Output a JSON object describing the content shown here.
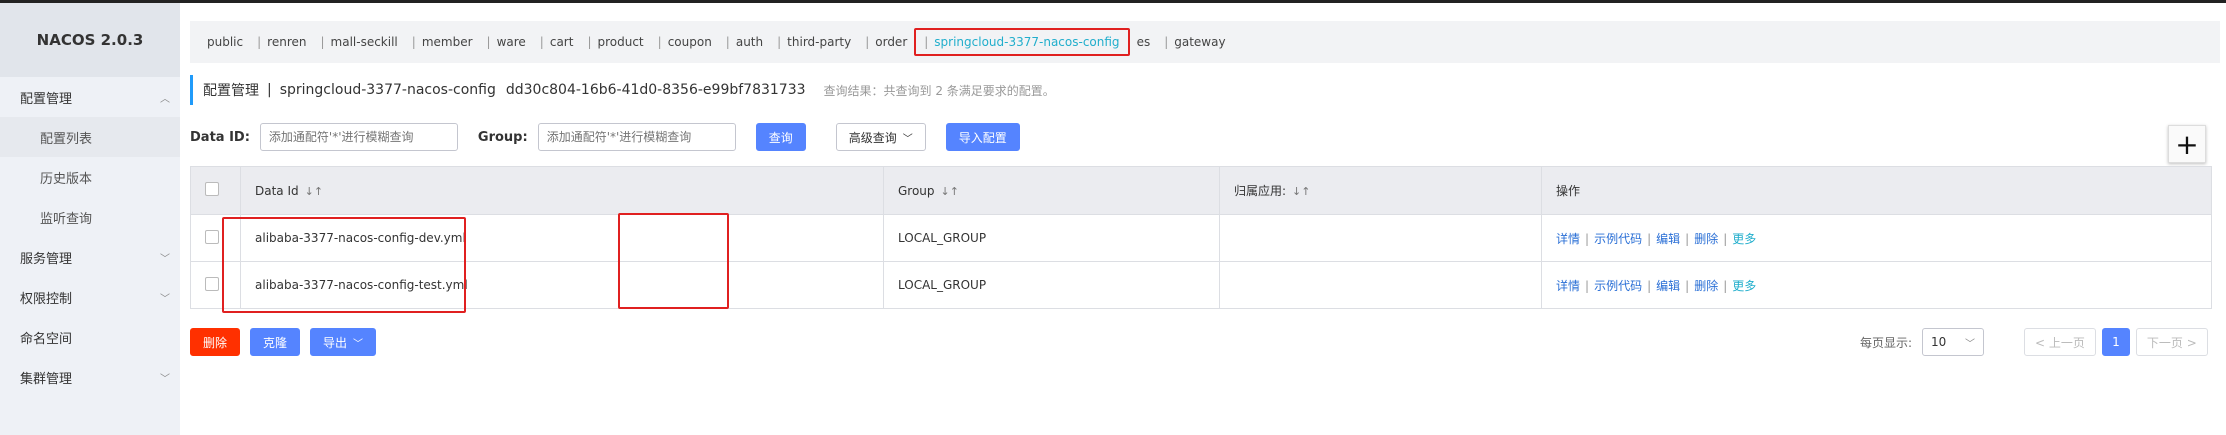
{
  "sidebar": {
    "brand": "NACOS 2.0.3",
    "items": [
      {
        "label": "配置管理",
        "chevron": "︿"
      },
      {
        "label": "配置列表"
      },
      {
        "label": "历史版本"
      },
      {
        "label": "监听查询"
      },
      {
        "label": "服务管理",
        "chevron": "﹀"
      },
      {
        "label": "权限控制",
        "chevron": "﹀"
      },
      {
        "label": "命名空间"
      },
      {
        "label": "集群管理",
        "chevron": "﹀"
      }
    ]
  },
  "namespaces": [
    "public",
    "renren",
    "mall-seckill",
    "member",
    "ware",
    "cart",
    "product",
    "coupon",
    "auth",
    "third-party",
    "order",
    "springcloud-3377-nacos-config",
    "es",
    "gateway"
  ],
  "header": {
    "title": "配置管理",
    "sep": "|",
    "namespace": "springcloud-3377-nacos-config",
    "namespace_id": "dd30c804-16b6-41d0-8356-e99bf7831733",
    "result": "查询结果：共查询到 2 条满足要求的配置。"
  },
  "filters": {
    "data_id_label": "Data ID:",
    "data_id_placeholder": "添加通配符'*'进行模糊查询",
    "group_label": "Group:",
    "group_placeholder": "添加通配符'*'进行模糊查询",
    "search_btn": "查询",
    "advanced_btn": "高级查询",
    "import_btn": "导入配置",
    "plus": "+"
  },
  "table": {
    "headers": {
      "data_id": "Data Id",
      "group": "Group",
      "app": "归属应用:",
      "ops": "操作"
    },
    "sort_glyph": "↓↑",
    "rows": [
      {
        "data_id": "alibaba-3377-nacos-config-dev.yml",
        "group": "LOCAL_GROUP",
        "app": ""
      },
      {
        "data_id": "alibaba-3377-nacos-config-test.yml",
        "group": "LOCAL_GROUP",
        "app": ""
      }
    ],
    "ops": {
      "detail": "详情",
      "sample": "示例代码",
      "edit": "编辑",
      "delete": "删除",
      "more": "更多",
      "bar": "|"
    }
  },
  "bottom": {
    "delete": "删除",
    "clone": "克隆",
    "export": "导出"
  },
  "pager": {
    "per_page_label": "每页显示:",
    "per_page": "10",
    "prev": "< 上一页",
    "current": "1",
    "next": "下一页 >"
  },
  "colors": {
    "accent": "#5584ff",
    "danger": "#ff3000",
    "highlight": "#e02020",
    "link": "#2a6fd6"
  }
}
